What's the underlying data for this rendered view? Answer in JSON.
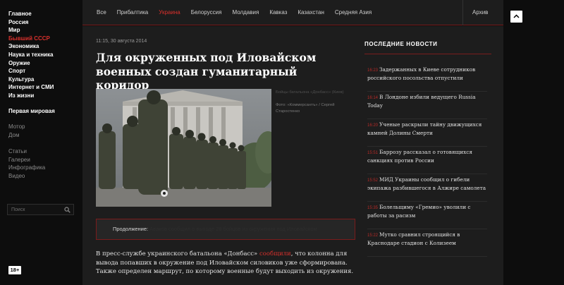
{
  "sidebar": {
    "sections": [
      {
        "label": "Главное",
        "active": false
      },
      {
        "label": "Россия",
        "active": false
      },
      {
        "label": "Мир",
        "active": false
      },
      {
        "label": "Бывший СССР",
        "active": true
      },
      {
        "label": "Экономика",
        "active": false
      },
      {
        "label": "Наука и техника",
        "active": false
      },
      {
        "label": "Оружие",
        "active": false
      },
      {
        "label": "Спорт",
        "active": false
      },
      {
        "label": "Культура",
        "active": false
      },
      {
        "label": "Интернет и СМИ",
        "active": false
      },
      {
        "label": "Из жизни",
        "active": false
      }
    ],
    "special": "Первая мировая",
    "projects": [
      "Мотор",
      "Дом"
    ],
    "formats": [
      "Статьи",
      "Галереи",
      "Инфографика",
      "Видео"
    ],
    "search_placeholder": "Поиск",
    "age_badge": "18+"
  },
  "topnav": {
    "items": [
      {
        "label": "Все",
        "active": false
      },
      {
        "label": "Прибалтика",
        "active": false
      },
      {
        "label": "Украина",
        "active": true
      },
      {
        "label": "Белоруссия",
        "active": false
      },
      {
        "label": "Молдавия",
        "active": false
      },
      {
        "label": "Кавказ",
        "active": false
      },
      {
        "label": "Казахстан",
        "active": false
      },
      {
        "label": "Средняя Азия",
        "active": false
      }
    ],
    "archive": "Архив"
  },
  "article": {
    "date": "11:15, 30 августа 2014",
    "title": "Для окруженных под Иловайском военных создан гуманитарный коридор",
    "caption": "Бойцы батальона «Донбасс» (Киев)",
    "credit": "Фото: «Коммерсантъ» / Сергей Старостенко",
    "continue_label": "Продолжение:",
    "continue_link": "Аваков сообщил о выходе 28 бойцов из окружения под Иловайском",
    "body_start": "В пресс-службе украинского батальона «Донбасс» ",
    "body_link": "сообщили",
    "body_rest": ", что колонна для вывода попавших в окружение под Иловайском силовиков уже сформирована. Также определен маршрут, по которому военные будут выходить из окружения."
  },
  "news": {
    "header": "ПОСЛЕДНИЕ НОВОСТИ",
    "items": [
      {
        "time": "16:23",
        "text": "Задержанных в Киеве сотрудников российского посольства отпустили"
      },
      {
        "time": "16:14",
        "text": "В Лондоне избили ведущего Russia Today"
      },
      {
        "time": "16:20",
        "text": "Ученые раскрыли тайну движущихся камней Долины Смерти"
      },
      {
        "time": "15:51",
        "text": "Баррозу рассказал о готовящихся санкциях против России"
      },
      {
        "time": "15:52",
        "text": "МИД Украины сообщил о гибели экипажа разбившегося в Алжире самолета"
      },
      {
        "time": "15:35",
        "text": "Болельщиму «Гремио» уволили с работы за расизм"
      },
      {
        "time": "15:22",
        "text": "Мутко сравнил строящийся в Краснодаре стадион с Колизеем"
      }
    ]
  },
  "colors": {
    "accent": "#d9302c",
    "panel": "#1d1d1d",
    "background": "#0d0d0d"
  }
}
